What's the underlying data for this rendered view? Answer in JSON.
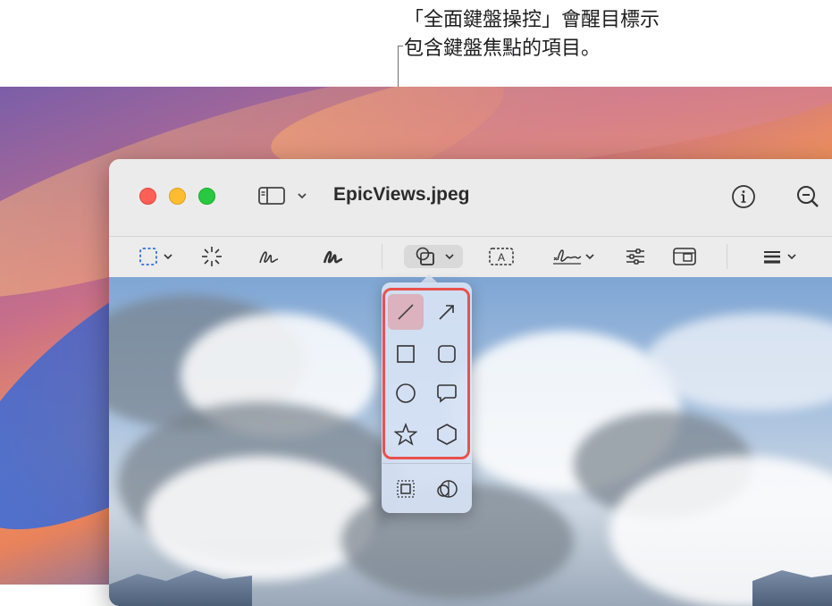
{
  "callout": {
    "line1": "「全面鍵盤操控」會醒目標示",
    "line2": "包含鍵盤焦點的項目。"
  },
  "window": {
    "title": "EpicViews.jpeg"
  },
  "toolbar": {
    "markup_text_label": "A"
  },
  "shapes_popover": {
    "items": [
      "line",
      "arrow",
      "square",
      "rounded-square",
      "circle",
      "speech-bubble",
      "star",
      "hexagon"
    ],
    "selected": "line",
    "extra_items": [
      "border",
      "mask"
    ]
  },
  "colors": {
    "focus_ring": "#e9514d",
    "accent_blue": "#2f6fe0"
  }
}
